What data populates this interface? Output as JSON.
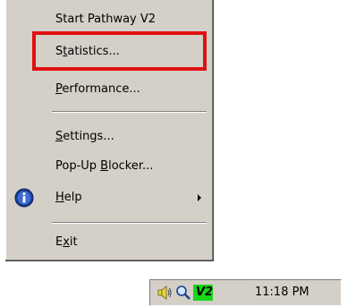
{
  "menu": {
    "items": [
      {
        "label": "Start Pathway V2",
        "access_key": ""
      },
      {
        "pre": "S",
        "key": "t",
        "post": "atistics..."
      },
      {
        "pre": "",
        "key": "P",
        "post": "erformance..."
      },
      {
        "pre": "",
        "key": "S",
        "post": "ettings..."
      },
      {
        "pre": "Pop-Up ",
        "key": "B",
        "post": "locker..."
      },
      {
        "pre": "",
        "key": "H",
        "post": "elp"
      },
      {
        "pre": "E",
        "key": "x",
        "post": "it"
      }
    ]
  },
  "tray": {
    "icons": [
      "speaker-icon",
      "magnifier-icon",
      "v2-icon"
    ],
    "v2_text": "V2",
    "clock": "11:18 PM"
  },
  "colors": {
    "highlight": "#e01010",
    "menu_bg": "#d4d0c8",
    "v2_green": "#19d619"
  }
}
